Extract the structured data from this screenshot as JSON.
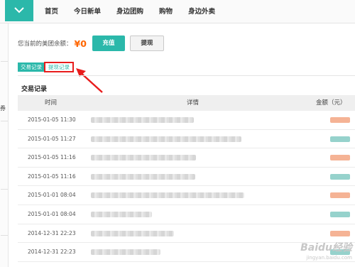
{
  "nav": {
    "items": [
      "首页",
      "今日新单",
      "身边团购",
      "购物",
      "身边外卖"
    ]
  },
  "sidebar": {
    "glyph": "券"
  },
  "balance": {
    "label": "您当前的美团余额：",
    "amount": "¥0",
    "recharge_label": "充值",
    "withdraw_label": "提现"
  },
  "tabs": {
    "transactions": "交易记录",
    "withdrawals": "提现记录"
  },
  "section_title": "交易记录",
  "table": {
    "headers": {
      "time": "时间",
      "detail": "详情",
      "amount": "金额（元）"
    },
    "rows": [
      {
        "time": "2015-01-05 11:30",
        "amount_color": "#f3a07a"
      },
      {
        "time": "2015-01-05 11:27",
        "amount_color": "#7cc7bf"
      },
      {
        "time": "2015-01-05 11:16",
        "amount_color": "#f3a07a"
      },
      {
        "time": "2015-01-05 11:16",
        "amount_color": "#7cc7bf"
      },
      {
        "time": "2015-01-01 08:04",
        "amount_color": "#f3a07a"
      },
      {
        "time": "2015-01-01 08:04",
        "amount_color": "#7cc7bf"
      },
      {
        "time": "2014-12-31 22:23",
        "amount_color": "#f3a07a"
      },
      {
        "time": "2014-12-31 22:23",
        "amount_color": "#7cc7bf"
      }
    ]
  },
  "colors": {
    "accent": "#2bb8aa",
    "price": "#ff6600",
    "highlight": "#e81c1c"
  },
  "watermark": {
    "main": "Baidu经验",
    "sub": "jingyan.baidu.com"
  }
}
